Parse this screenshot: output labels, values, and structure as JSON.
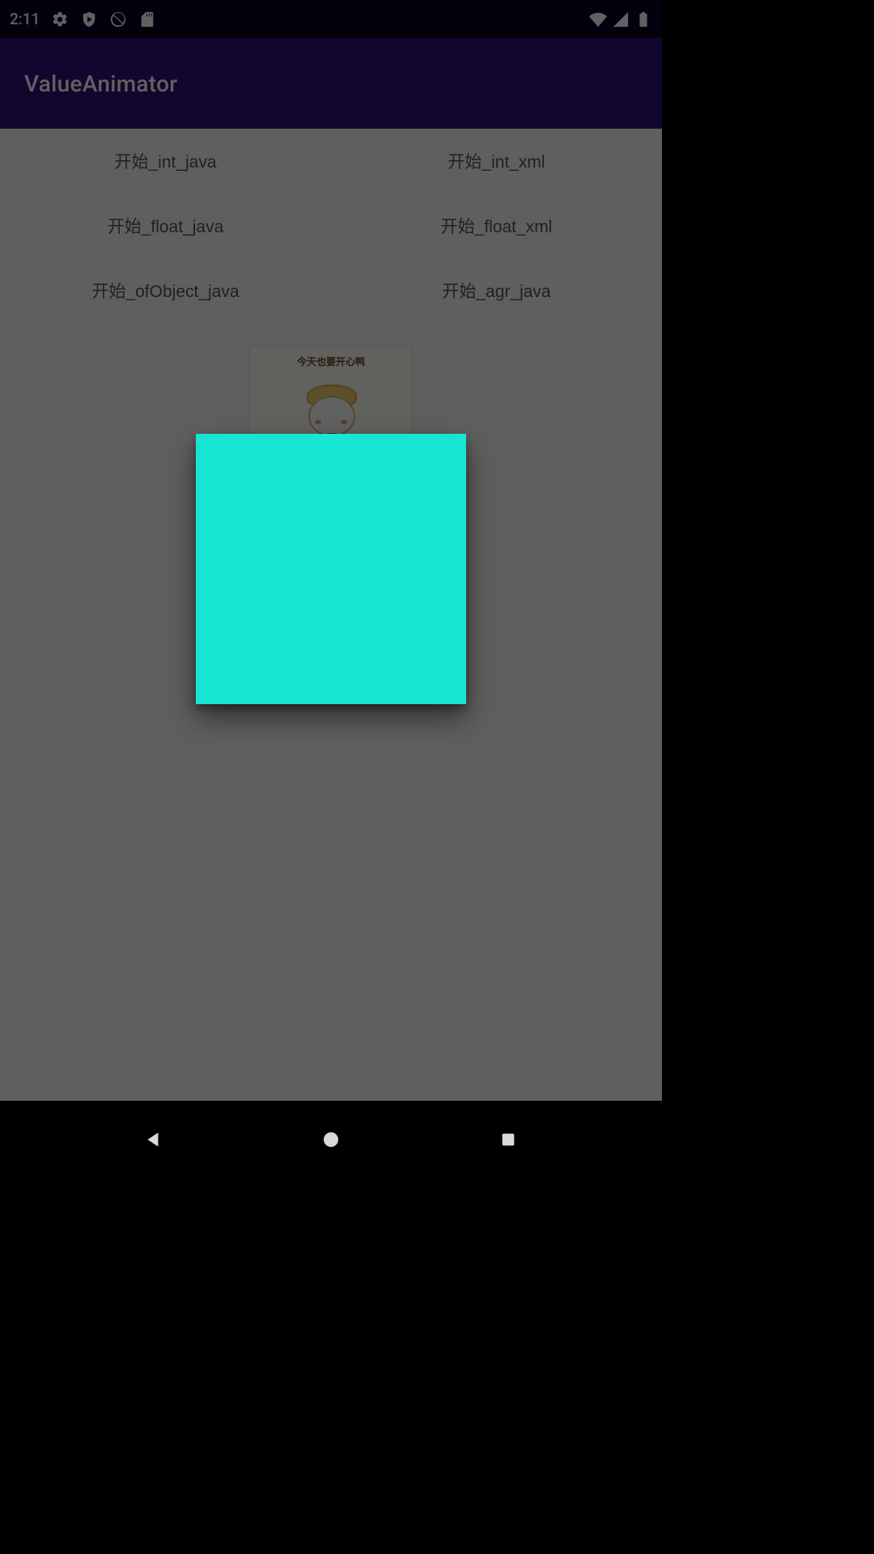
{
  "status": {
    "time": "2:11"
  },
  "appbar": {
    "title": "ValueAnimator"
  },
  "buttons": {
    "int_java": "开始_int_java",
    "int_xml": "开始_int_xml",
    "float_java": "开始_float_java",
    "float_xml": "开始_float_xml",
    "ofobject_java": "开始_ofObject_java",
    "agr_java": "开始_agr_java"
  },
  "cartoon": {
    "caption": "今天也要开心鸭"
  },
  "dialog": {
    "color": "#18e6d5"
  }
}
